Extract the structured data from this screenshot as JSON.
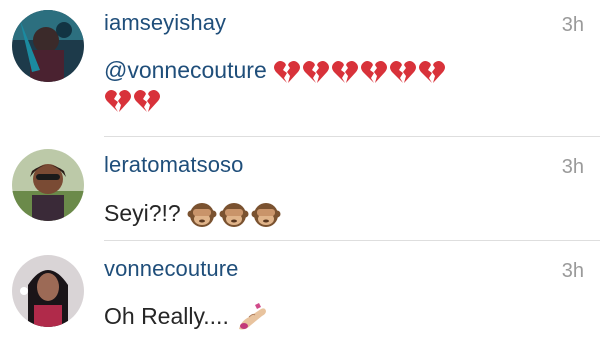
{
  "comments": [
    {
      "username": "iamseyishay",
      "time": "3h",
      "mention": "@vonnecouture",
      "emojis": [
        "broken-heart",
        "broken-heart",
        "broken-heart",
        "broken-heart",
        "broken-heart",
        "broken-heart",
        "broken-heart",
        "broken-heart"
      ]
    },
    {
      "username": "leratomatsoso",
      "time": "3h",
      "text": "Seyi?!?",
      "emojis": [
        "see-no-evil-monkey",
        "see-no-evil-monkey",
        "see-no-evil-monkey"
      ]
    },
    {
      "username": "vonnecouture",
      "time": "3h",
      "text": "Oh Really....",
      "emojis": [
        "nail-polish"
      ]
    }
  ],
  "colors": {
    "username": "#1f4e7a",
    "time": "#9a9a9a",
    "text": "#262626",
    "divider": "#dedede",
    "heart": "#d8323a"
  }
}
